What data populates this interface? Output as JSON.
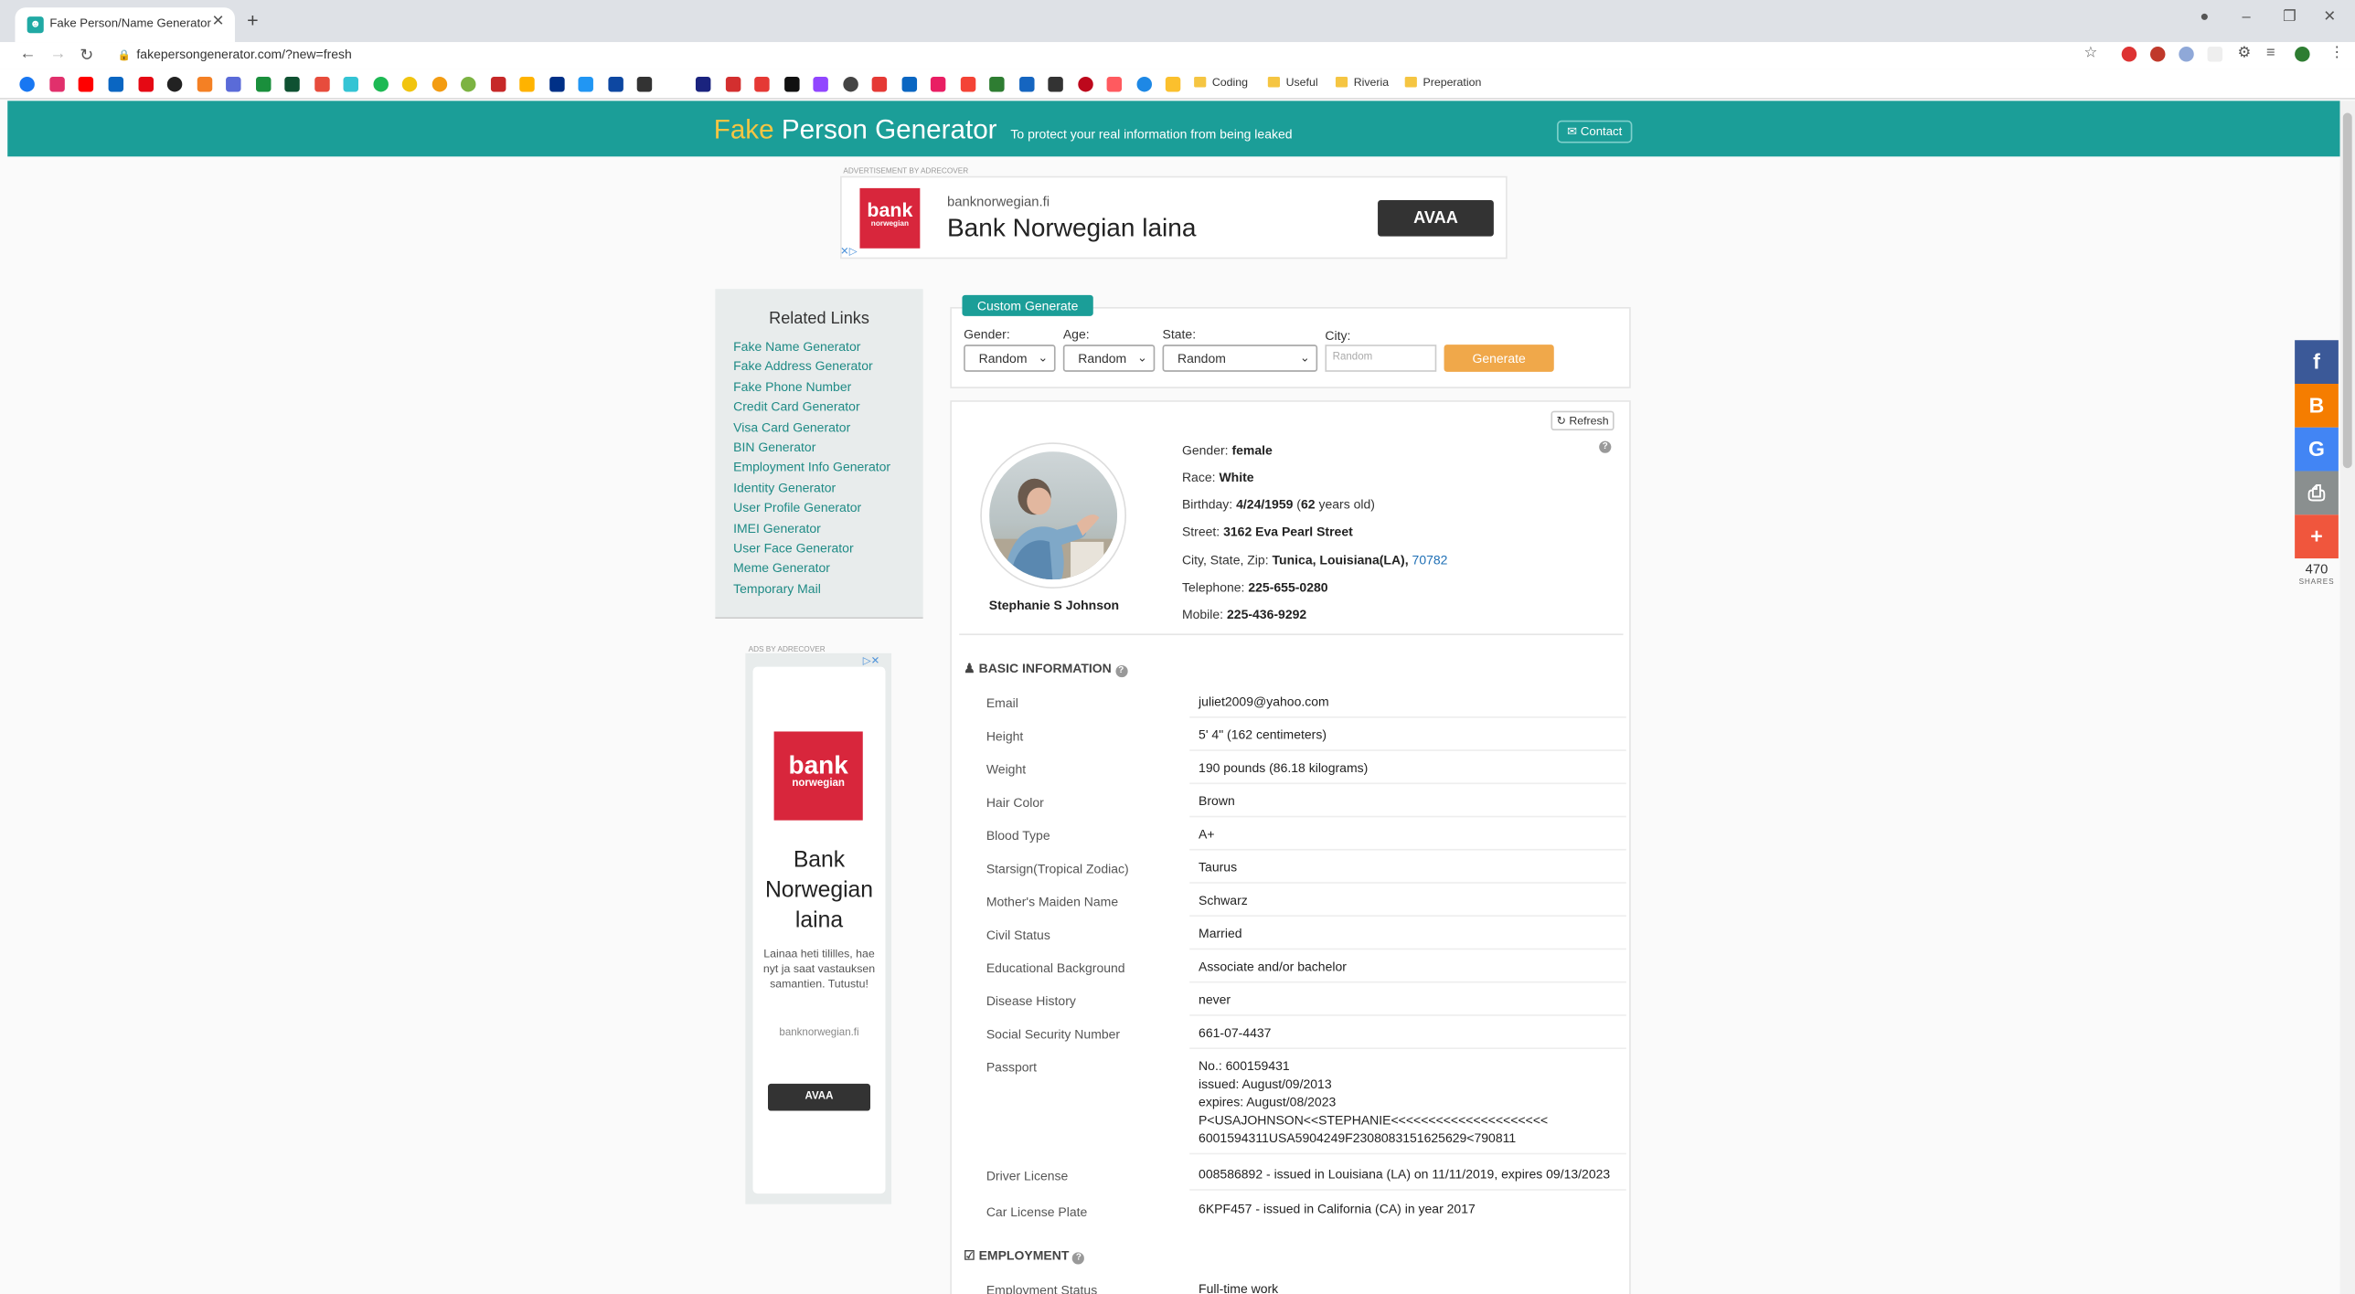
{
  "browser": {
    "tab_title": "Fake Person/Name Generator | U",
    "url": "fakepersongenerator.com/?new=fresh",
    "bookmark_folders": [
      "Coding",
      "Useful",
      "Riveria",
      "Preperation"
    ]
  },
  "header": {
    "brand_fake": "Fake",
    "brand_rest": "Person Generator",
    "tagline": "To protect your real information from being leaked",
    "contact_label": "Contact"
  },
  "banner_ad": {
    "caption": "ADVERTISEMENT BY ADRECOVER",
    "logo_line1": "bank",
    "logo_line2": "norwegian",
    "domain": "banknorwegian.fi",
    "headline": "Bank Norwegian laina",
    "cta": "AVAA"
  },
  "sidebar": {
    "title": "Related Links",
    "links": [
      "Fake Name Generator",
      "Fake Address Generator",
      "Fake Phone Number",
      "Credit Card Generator",
      "Visa Card Generator",
      "BIN Generator",
      "Employment Info Generator",
      "Identity Generator",
      "User Profile Generator",
      "IMEI Generator",
      "User Face Generator",
      "Meme Generator",
      "Temporary Mail"
    ]
  },
  "side_ad": {
    "caption": "ADS BY ADRECOVER",
    "logo_line1": "bank",
    "logo_line2": "norwegian",
    "headline": "Bank Norwegian laina",
    "description": "Lainaa heti tililles, hae nyt ja saat vastauksen samantien. Tutustu!",
    "domain": "banknorwegian.fi",
    "cta": "AVAA"
  },
  "custom_generate": {
    "button": "Custom Generate",
    "gender_label": "Gender:",
    "gender_value": "Random",
    "age_label": "Age:",
    "age_value": "Random",
    "state_label": "State:",
    "state_value": "Random",
    "city_label": "City:",
    "city_placeholder": "Random",
    "generate_button": "Generate"
  },
  "profile": {
    "refresh_label": "Refresh",
    "name": "Stephanie S Johnson",
    "summary": {
      "gender_label": "Gender:",
      "gender": "female",
      "race_label": "Race:",
      "race": "White",
      "birthday_label": "Birthday:",
      "birthday": "4/24/1959",
      "age": "62",
      "age_suffix": "years old)",
      "street_label": "Street:",
      "street": "3162 Eva Pearl Street",
      "city_label": "City, State, Zip:",
      "city_state": "Tunica, Louisiana(LA),",
      "zip": "70782",
      "telephone_label": "Telephone:",
      "telephone": "225-655-0280",
      "mobile_label": "Mobile:",
      "mobile": "225-436-9292"
    }
  },
  "basic_info": {
    "title": "BASIC INFORMATION",
    "rows": [
      {
        "label": "Email",
        "value": "juliet2009@yahoo.com"
      },
      {
        "label": "Height",
        "value": "5' 4\" (162 centimeters)"
      },
      {
        "label": "Weight",
        "value": "190 pounds (86.18 kilograms)"
      },
      {
        "label": "Hair Color",
        "value": "Brown"
      },
      {
        "label": "Blood Type",
        "value": "A+"
      },
      {
        "label": "Starsign(Tropical Zodiac)",
        "value": "Taurus"
      },
      {
        "label": "Mother's Maiden Name",
        "value": "Schwarz"
      },
      {
        "label": "Civil Status",
        "value": "Married"
      },
      {
        "label": "Educational Background",
        "value": "Associate and/or bachelor"
      },
      {
        "label": "Disease History",
        "value": "never"
      },
      {
        "label": "Social Security Number",
        "value": "661-07-4437"
      }
    ],
    "passport": {
      "label": "Passport",
      "number": "No.: 600159431",
      "issued": "issued: August/09/2013",
      "expires": "expires: August/08/2023",
      "mrz1": "P<USAJOHNSON<<STEPHANIE<<<<<<<<<<<<<<<<<<<<<",
      "mrz2": "6001594311USA5904249F2308083151625629<790811"
    },
    "driver_license": {
      "label": "Driver License",
      "value": "008586892 - issued in Louisiana (LA) on 11/11/2019, expires 09/13/2023"
    },
    "car_plate": {
      "label": "Car License Plate",
      "value": "6KPF457 - issued in California (CA) in year 2017"
    }
  },
  "employment": {
    "title": "EMPLOYMENT",
    "status_label": "Employment Status",
    "status_value": "Full-time work"
  },
  "share": {
    "count": "470",
    "label": "SHARES",
    "colors": {
      "facebook": "#3b5998",
      "blogger": "#f57d00",
      "google": "#4285f4",
      "print": "#8a8f8f",
      "more": "#f0563d"
    }
  }
}
